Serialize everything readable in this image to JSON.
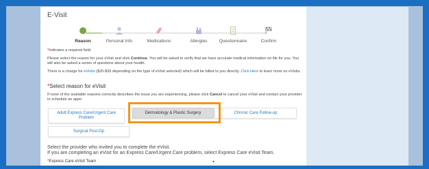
{
  "app": {
    "title": "E-Visit"
  },
  "steps": [
    {
      "label": "Reason",
      "icon": "dot-icon",
      "active": true
    },
    {
      "label": "Personal Info",
      "icon": "person-icon"
    },
    {
      "label": "Medications",
      "icon": "pill-icon"
    },
    {
      "label": "Allergies",
      "icon": "allergy-icon"
    },
    {
      "label": "Questionnaire",
      "icon": "questionnaire-icon"
    },
    {
      "label": "Confirm",
      "icon": "checkered-flag-icon"
    }
  ],
  "required_note": {
    "star": "*",
    "text": "Indicates a required field"
  },
  "intro": {
    "part1": "Please select the reason for your eVisit and click ",
    "continue": "Continue",
    "part2": ". You will be asked to verify that we have accurate medical information on file for you. You will also be asked a series of questions about your health."
  },
  "charge": {
    "part1": "There is a charge for ",
    "evisits_link": "eVisits",
    "part2": " ($20-$35 depending on the type of eVisit selected) which will be billed to you directly. ",
    "click_here": "Click Here",
    "part3": " to learn more on eVisits."
  },
  "reason_heading": {
    "star": "*",
    "text": "Select reason for eVisit"
  },
  "reason_help": {
    "part1": "If none of the available reasons correctly describes the issue you are experiencing, please click ",
    "cancel": "Cancel",
    "part2": " to cancel your eVisit and contact your provider to schedule an appo"
  },
  "reasons": [
    {
      "label": "Adult Express Care/Urgent Care Problem"
    },
    {
      "label": "Dermatology & Plastic Surgery",
      "selected": true
    },
    {
      "label": "Chronic Care Follow-up"
    },
    {
      "label": "Surgical Post-Op"
    }
  ],
  "provider": {
    "line1": "Select the provider who invited you to complete the eVisit.",
    "line2": "If you are completing an eVisit for an Express Care/Urgent Care problem, select Express Care eVisit Team.",
    "star": "*",
    "selected": "Express Care eVisit Team",
    "chevron": "chevron-down-icon"
  },
  "colors": {
    "accent": "#1e77c9",
    "highlight": "#f39519",
    "active_step": "#77a843",
    "required": "#d0021b",
    "background": "#1a6fc2"
  }
}
